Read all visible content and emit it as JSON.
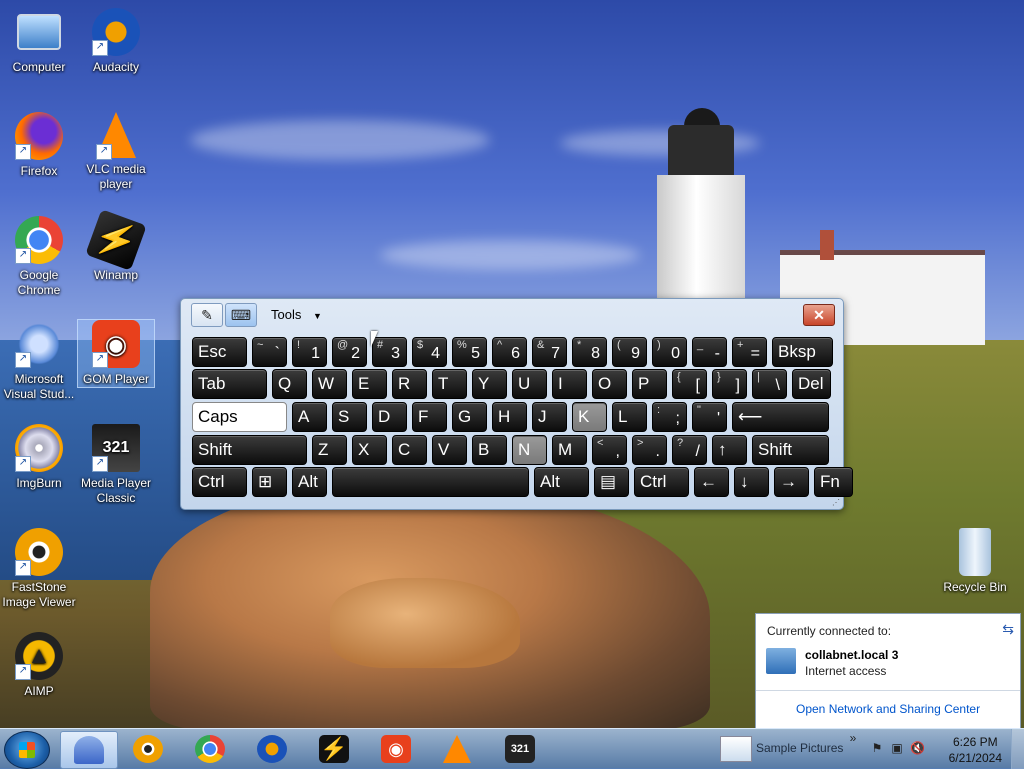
{
  "desktop": {
    "icons": [
      {
        "label": "Computer",
        "icon": "computer-icon"
      },
      {
        "label": "Audacity",
        "icon": "audacity-icon"
      },
      {
        "label": "Firefox",
        "icon": "firefox-icon"
      },
      {
        "label": "VLC media player",
        "icon": "vlc-icon"
      },
      {
        "label": "Google Chrome",
        "icon": "chrome-icon"
      },
      {
        "label": "Winamp",
        "icon": "winamp-icon"
      },
      {
        "label": "Microsoft Visual Stud...",
        "icon": "visual-studio-icon"
      },
      {
        "label": "GOM Player",
        "icon": "gom-player-icon"
      },
      {
        "label": "ImgBurn",
        "icon": "imgburn-icon"
      },
      {
        "label": "Media Player Classic",
        "icon": "media-player-classic-icon"
      },
      {
        "label": "FastStone Image Viewer",
        "icon": "faststone-icon"
      },
      {
        "label": "AIMP",
        "icon": "aimp-icon"
      },
      {
        "label": "Recycle Bin",
        "icon": "recycle-bin-icon"
      }
    ]
  },
  "osk": {
    "tools_label": "Tools",
    "close_glyph": "✕",
    "rows": [
      [
        {
          "main": "Esc",
          "style": "label"
        },
        {
          "sub": "~",
          "main": "`"
        },
        {
          "sub": "!",
          "main": "1"
        },
        {
          "sub": "@",
          "main": "2"
        },
        {
          "sub": "#",
          "main": "3"
        },
        {
          "sub": "$",
          "main": "4"
        },
        {
          "sub": "%",
          "main": "5"
        },
        {
          "sub": "^",
          "main": "6"
        },
        {
          "sub": "&",
          "main": "7"
        },
        {
          "sub": "*",
          "main": "8"
        },
        {
          "sub": "(",
          "main": "9"
        },
        {
          "sub": ")",
          "main": "0"
        },
        {
          "sub": "_",
          "main": "-"
        },
        {
          "sub": "+",
          "main": "="
        },
        {
          "main": "Bksp",
          "style": "label"
        }
      ],
      [
        {
          "main": "Tab",
          "style": "label"
        },
        {
          "main": "Q"
        },
        {
          "main": "W"
        },
        {
          "main": "E"
        },
        {
          "main": "R"
        },
        {
          "main": "T"
        },
        {
          "main": "Y"
        },
        {
          "main": "U"
        },
        {
          "main": "I"
        },
        {
          "main": "O"
        },
        {
          "main": "P"
        },
        {
          "sub": "{",
          "main": "["
        },
        {
          "sub": "}",
          "main": "]"
        },
        {
          "sub": "|",
          "main": "\\"
        },
        {
          "main": "Del",
          "style": "label"
        }
      ],
      [
        {
          "main": "Caps",
          "style": "label",
          "state": "on"
        },
        {
          "main": "A"
        },
        {
          "main": "S"
        },
        {
          "main": "D"
        },
        {
          "main": "F"
        },
        {
          "main": "G"
        },
        {
          "main": "H"
        },
        {
          "main": "J"
        },
        {
          "main": "K",
          "state": "hover"
        },
        {
          "main": "L"
        },
        {
          "sub": ":",
          "main": ";"
        },
        {
          "sub": "\"",
          "main": "'"
        },
        {
          "main": "⟵",
          "style": "label"
        }
      ],
      [
        {
          "main": "Shift",
          "style": "label"
        },
        {
          "main": "Z"
        },
        {
          "main": "X"
        },
        {
          "main": "C"
        },
        {
          "main": "V"
        },
        {
          "main": "B"
        },
        {
          "main": "N",
          "state": "hover"
        },
        {
          "main": "M"
        },
        {
          "sub": "<",
          "main": ","
        },
        {
          "sub": ">",
          "main": "."
        },
        {
          "sub": "?",
          "main": "/"
        },
        {
          "main": "↑",
          "style": "label"
        },
        {
          "main": "Shift",
          "style": "label"
        }
      ],
      [
        {
          "main": "Ctrl",
          "style": "label"
        },
        {
          "main": "⊞",
          "style": "label"
        },
        {
          "main": "Alt",
          "style": "label"
        },
        {
          "main": "",
          "style": "label"
        },
        {
          "main": "Alt",
          "style": "label"
        },
        {
          "main": "▤",
          "style": "label"
        },
        {
          "main": "Ctrl",
          "style": "label"
        },
        {
          "main": "←",
          "style": "label"
        },
        {
          "main": "↓",
          "style": "label"
        },
        {
          "main": "→",
          "style": "label"
        },
        {
          "main": "Fn",
          "style": "label"
        }
      ]
    ]
  },
  "network_popup": {
    "heading": "Currently connected to:",
    "network_name": "collabnet.local  3",
    "network_status": "Internet access",
    "link": "Open Network and Sharing Center"
  },
  "taskbar": {
    "pinned": [
      "start-orb",
      "osk-icon",
      "faststone-icon",
      "chrome-icon",
      "audacity-icon",
      "winamp-icon",
      "gom-player-icon",
      "vlc-icon",
      "media-player-classic-icon"
    ],
    "toolbar_label": "Sample Pictures",
    "time": "6:26 PM",
    "date": "6/21/2024"
  }
}
